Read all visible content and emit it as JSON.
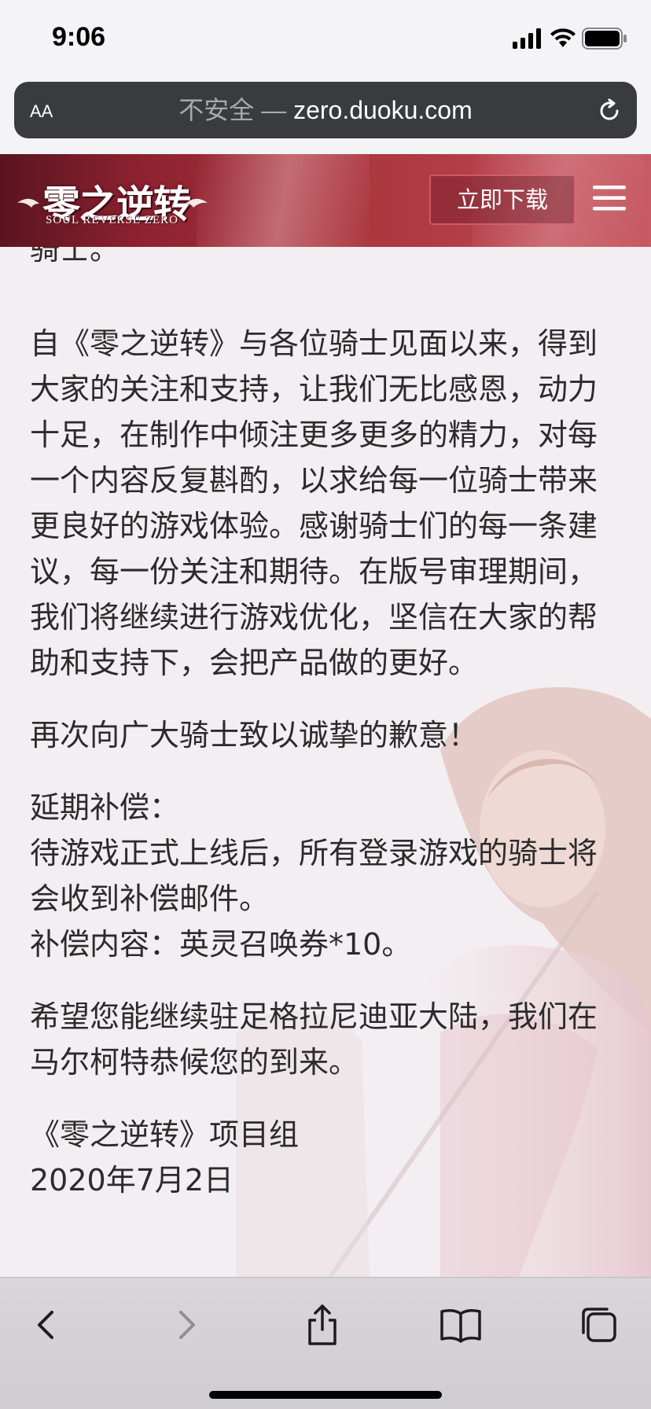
{
  "status_bar": {
    "time": "9:06"
  },
  "browser": {
    "text_size_label": "AA",
    "insecure_label": "不安全",
    "separator": " — ",
    "domain": "zero.duoku.com"
  },
  "site_header": {
    "logo_text": "零之逆转",
    "logo_subtitle": "SOUL REVERSE ZERO",
    "download_label": "立即下载"
  },
  "article": {
    "p0": "骑士。",
    "p1": "自《零之逆转》与各位骑士见面以来，得到大家的关注和支持，让我们无比感恩，动力十足，在制作中倾注更多更多的精力，对每一个内容反复斟酌，以求给每一位骑士带来更良好的游戏体验。感谢骑士们的每一条建议，每一份关注和期待。在版号审理期间，我们将继续进行游戏优化，坚信在大家的帮助和支持下，会把产品做的更好。",
    "p2": "再次向广大骑士致以诚挚的歉意！",
    "p3_title": "延期补偿：",
    "p3_line1": "待游戏正式上线后，所有登录游戏的骑士将会收到补偿邮件。",
    "p3_line2": "补偿内容：英灵召唤券*10。",
    "p4": "希望您能继续驻足格拉尼迪亚大陆，我们在马尔柯特恭候您的到来。",
    "signature": "《零之逆转》项目组",
    "date": "2020年7月2日"
  },
  "colors": {
    "header_red": "#a8343c",
    "url_bar_bg": "#3a3b3d",
    "text": "#2b2b2b",
    "toolbar_icon": "#1c1c1e",
    "toolbar_icon_disabled": "#8e8e93"
  },
  "toolbar": {
    "back": "chevron-left-icon",
    "forward": "chevron-right-icon",
    "share": "share-icon",
    "bookmarks": "book-icon",
    "tabs": "tabs-icon"
  }
}
